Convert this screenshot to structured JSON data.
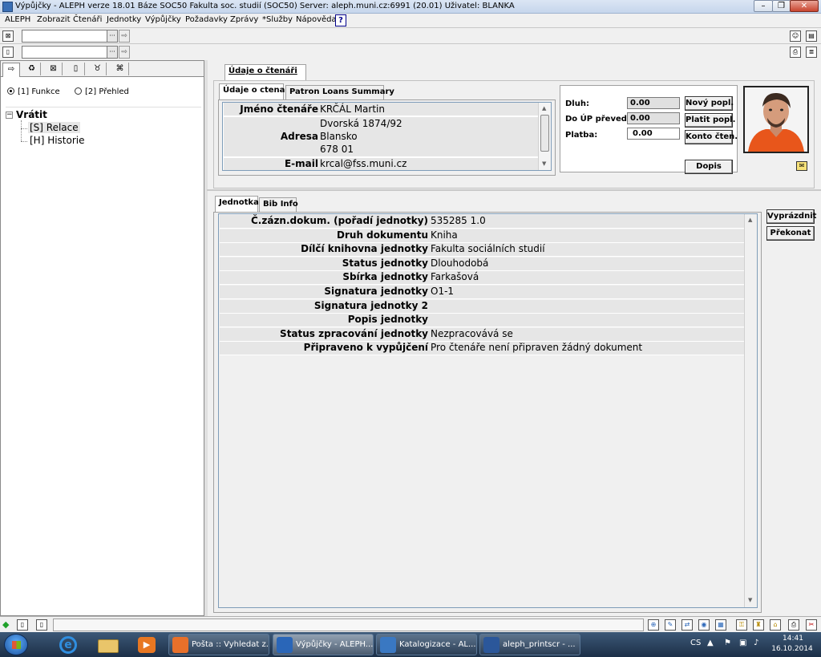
{
  "window": {
    "title": "Výpůjčky - ALEPH verze 18.01  Báze SOC50 Fakulta soc. studií (SOC50)  Server: aleph.muni.cz:6991 (20.01)  Uživatel: BLANKA",
    "minimize": "–",
    "maximize": "❐",
    "close": "✕"
  },
  "menu": {
    "items": [
      "ALEPH",
      "Zobrazit",
      "Čtenáři",
      "Jednotky",
      "Výpůjčky",
      "Požadavky",
      "Zprávy",
      "*Služby",
      "Nápověda"
    ],
    "help_icon": "?"
  },
  "left": {
    "tabs": [
      "⇨",
      "♻",
      "⊠",
      "▯",
      "♉",
      "⌘"
    ],
    "radio_funkce": "[1] Funkce",
    "radio_prehled": "[2] Přehled",
    "tree_root": "Vrátit",
    "tree_collapse": "⊟",
    "tree_items": [
      "[S] Relace",
      "[H] Historie"
    ]
  },
  "patron": {
    "outer_tab": "Údaje o čtenáři",
    "tabs": [
      "Údaje o ctenari",
      "Patron Loans Summary"
    ],
    "labels": {
      "name": "Jméno čtenáře",
      "address": "Adresa",
      "email": "E-mail"
    },
    "values": {
      "name": "KRČÁL Martin",
      "address_lines": [
        "Dvorská 1874/92",
        "Blansko",
        "678 01"
      ],
      "email": "krcal@fss.muni.cz"
    }
  },
  "finance": {
    "dluh_label": "Dluh:",
    "dluh_value": "0.00",
    "do_up_label": "Do ÚP převed.:",
    "do_up_value": "0.00",
    "platba_label": "Platba:",
    "platba_value": "0.00",
    "btn_novy": "Nový popl.",
    "btn_platit": "Platit popl.",
    "btn_konto": "Konto čten.",
    "btn_dopis": "Dopis"
  },
  "item": {
    "tabs": [
      "Jednotka",
      "Bib Info"
    ],
    "rows": [
      {
        "label": "Č.zázn.dokum. (pořadí jednotky)",
        "value": "535285 1.0"
      },
      {
        "label": "Druh dokumentu",
        "value": "Kniha"
      },
      {
        "label": "Dílčí knihovna jednotky",
        "value": "Fakulta sociálních studií"
      },
      {
        "label": "Status jednotky",
        "value": "Dlouhodobá"
      },
      {
        "label": "Sbírka jednotky",
        "value": "Farkašová"
      },
      {
        "label": "Signatura jednotky",
        "value": "O1-1"
      },
      {
        "label": "Signatura jednotky 2",
        "value": ""
      },
      {
        "label": "Popis jednotky",
        "value": ""
      },
      {
        "label": "Status zpracování jednotky",
        "value": "Nezpracovává se"
      },
      {
        "label": "Připraveno k vypůjčení",
        "value": "Pro čtenáře není připraven žádný dokument"
      }
    ],
    "btn_vyprazdnit": "Vyprázdnit",
    "btn_prekonat": "Překonat"
  },
  "taskbar": {
    "items": [
      {
        "label": "Pošta :: Vyhledat z...",
        "color": "#e8702a"
      },
      {
        "label": "Výpůjčky - ALEPH...",
        "color": "#2a66b8"
      },
      {
        "label": "Katalogizace - AL...",
        "color": "#3a78c2"
      },
      {
        "label": "aleph_printscr - ...",
        "color": "#2b579a"
      }
    ],
    "lang": "CS",
    "time": "14:41",
    "date": "16.10.2014"
  },
  "colors": {
    "accent": "#2a66b8",
    "row_bg": "#e6e6e6"
  }
}
